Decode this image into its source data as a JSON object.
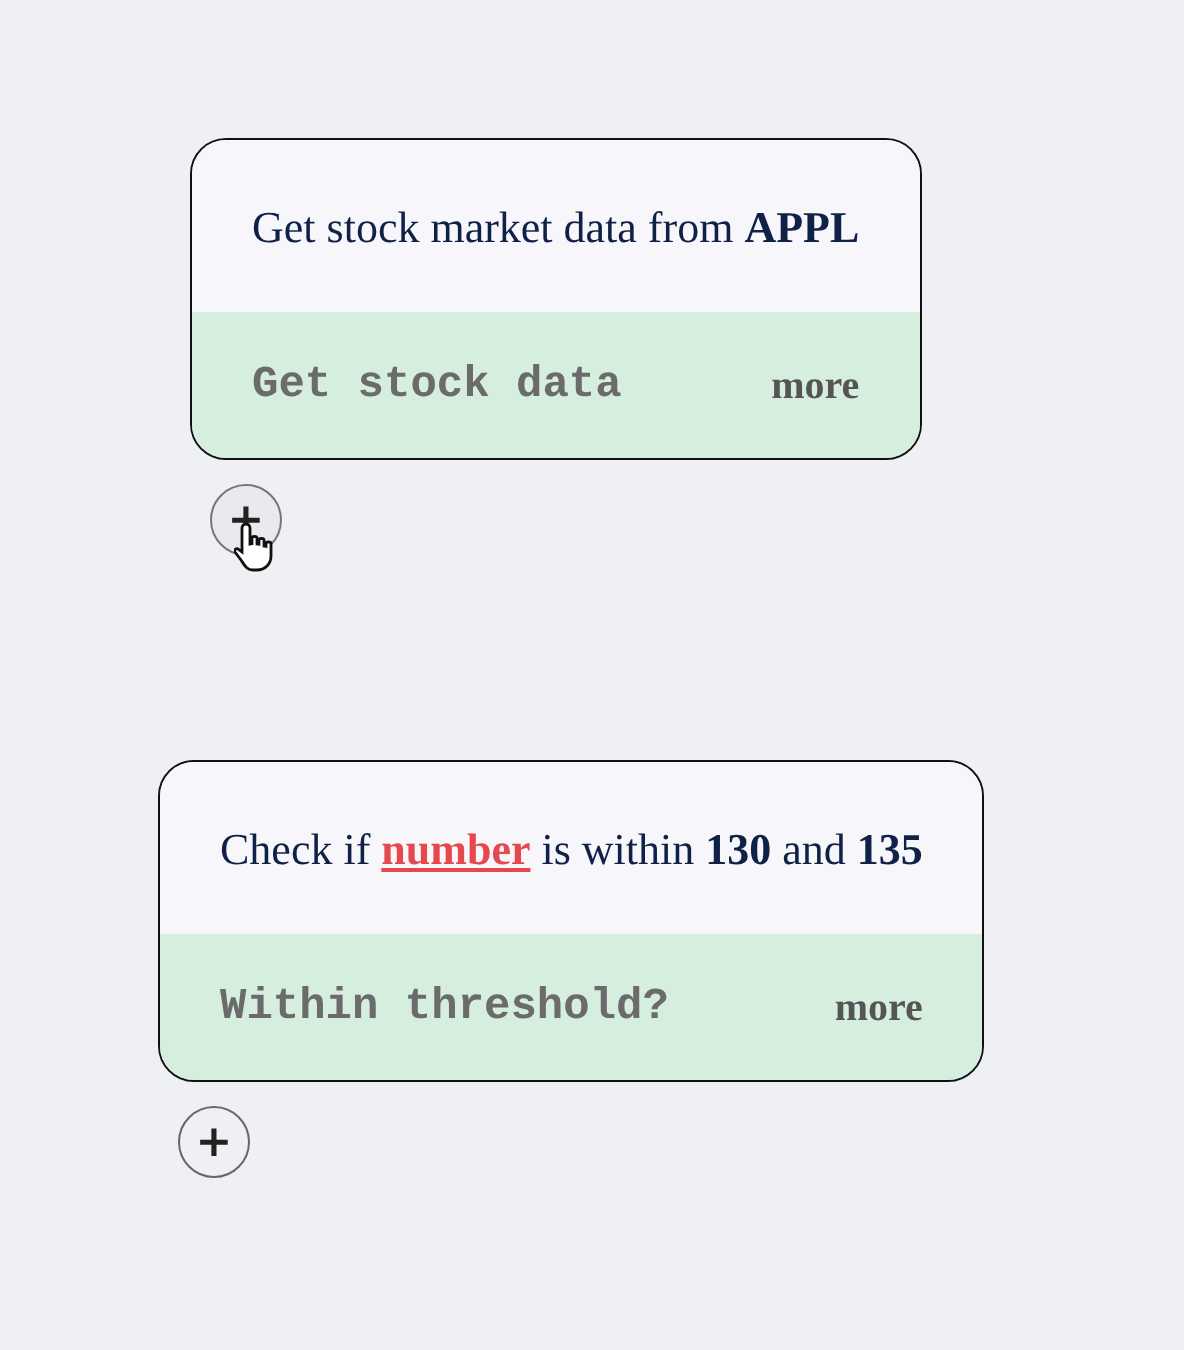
{
  "blocks": [
    {
      "description": [
        {
          "kind": "text",
          "text": "Get stock market data from "
        },
        {
          "kind": "bold",
          "text": "APPL"
        }
      ],
      "title": "Get stock data",
      "more": "more",
      "add": "+",
      "hovered": true
    },
    {
      "description": [
        {
          "kind": "text",
          "text": "Check if "
        },
        {
          "kind": "variable",
          "text": "number"
        },
        {
          "kind": "text",
          "text": " is within "
        },
        {
          "kind": "bold",
          "text": "130"
        },
        {
          "kind": "text",
          "text": " and "
        },
        {
          "kind": "bold",
          "text": "135"
        }
      ],
      "title": "Within threshold?",
      "more": "more",
      "add": "+",
      "hovered": false
    }
  ]
}
